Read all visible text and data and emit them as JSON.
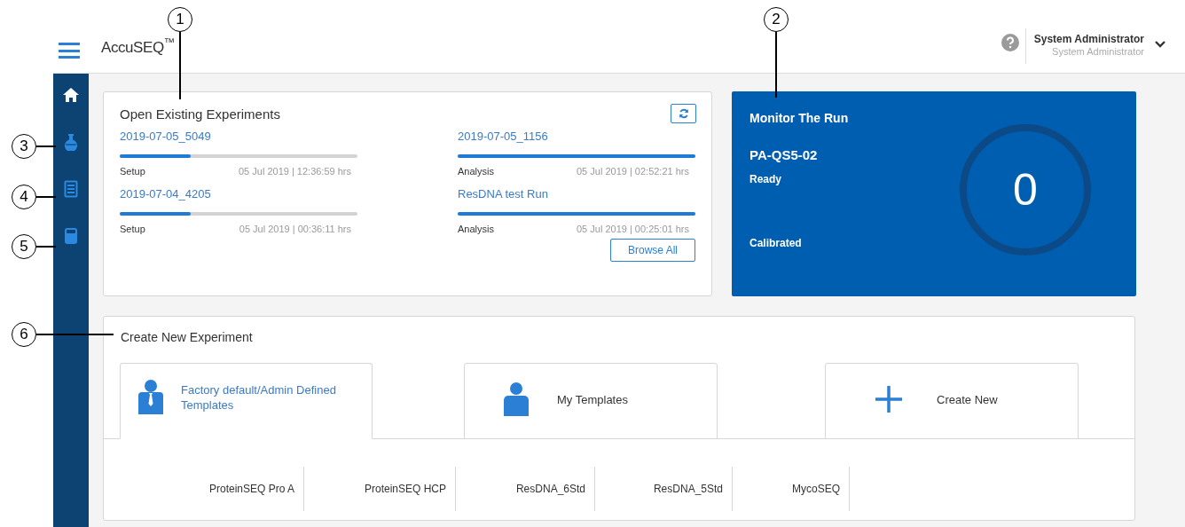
{
  "header": {
    "logo": "AccuSEQ$^{™}$",
    "user_name": "System Administrator",
    "user_role": "System Administrator"
  },
  "sidebar": {
    "items": [
      {
        "kind": "home",
        "selected": true
      },
      {
        "kind": "flask",
        "selected": false
      },
      {
        "kind": "document",
        "selected": false
      },
      {
        "kind": "beaker",
        "selected": false
      }
    ]
  },
  "open_experiments": {
    "title": "Open Existing Experiments",
    "experiments": [
      {
        "name": "2019-07-05_5049",
        "level": 0.3,
        "stage": "Setup",
        "timestamp": "05 Jul 2019 | 12:36:59 hrs"
      },
      {
        "name": "2019-07-05_1156",
        "level": 1,
        "stage": "Analysis",
        "timestamp": "05 Jul 2019 | 02:52:21 hrs"
      },
      {
        "name": "2019-07-04_4205",
        "level": 0.3,
        "stage": "Setup",
        "timestamp": "05 Jul 2019 | 00:36:11 hrs"
      },
      {
        "name": "ResDNA test Run",
        "level": 1,
        "stage": "Analysis",
        "timestamp": "05 Jul 2019 | 00:25:01 hrs"
      }
    ],
    "browse_button": "Browse All"
  },
  "monitor": {
    "title": "Monitor The Run",
    "instrument": "PA-QS5-02",
    "status": "Ready",
    "calibration": "Calibrated",
    "count": "0"
  },
  "create_experiment": {
    "title": "Create New Experiment",
    "tabs": [
      {
        "kind": "admin",
        "label": "Factory default/Admin Defined Templates",
        "selected": true
      },
      {
        "kind": "user",
        "label": "My Templates",
        "selected": false
      },
      {
        "kind": "plus",
        "label": "Create New",
        "selected": false
      }
    ],
    "templates": [
      "ProteinSEQ Pro A",
      "ProteinSEQ HCP",
      "ResDNA_6Std",
      "ResDNA_5Std",
      "MycoSEQ"
    ]
  },
  "callouts": [
    "1",
    "2",
    "3",
    "4",
    "5",
    "6"
  ]
}
